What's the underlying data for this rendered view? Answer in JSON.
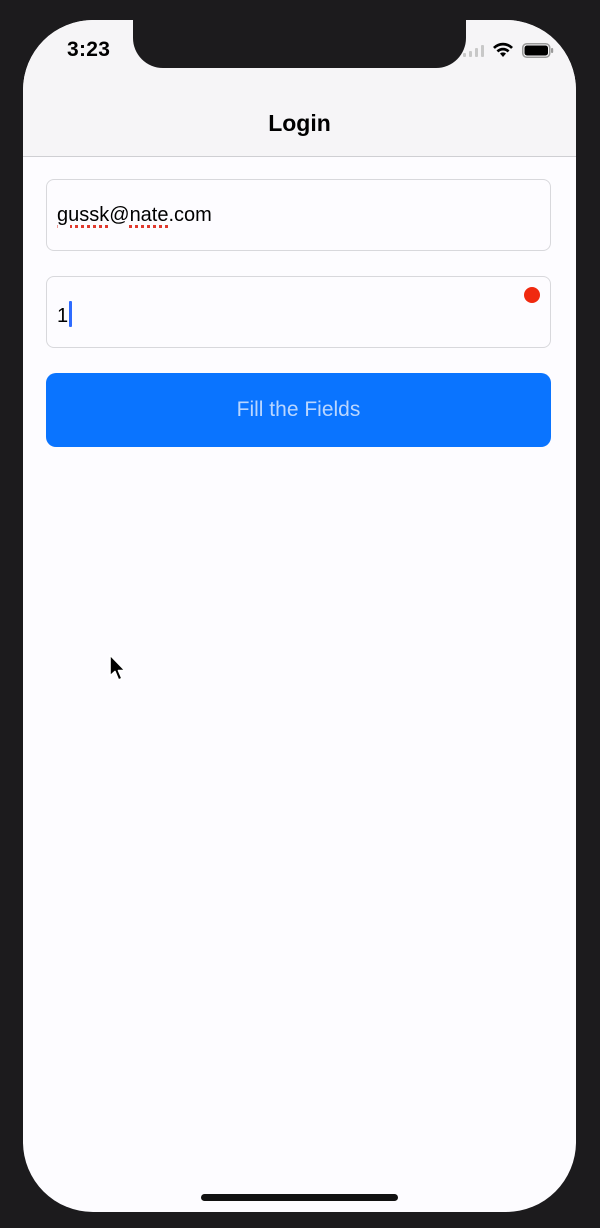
{
  "status_bar": {
    "time": "3:23",
    "icons": [
      "signal-icon",
      "wifi-icon",
      "battery-icon"
    ]
  },
  "nav": {
    "title": "Login"
  },
  "form": {
    "email_value": "gussk@nate.com",
    "email_misspelled_parts": [
      "gussk",
      "nate"
    ],
    "password_value": "1",
    "password_focused": true,
    "submit_label": "Fill the Fields",
    "submit_enabled": false
  },
  "colors": {
    "accent": "#0a74ff",
    "button_text_disabled": "#b9d6ff",
    "record_dot": "#f0290f",
    "spell_underline": "#e03a2e",
    "cursor": "#2e6bff"
  }
}
